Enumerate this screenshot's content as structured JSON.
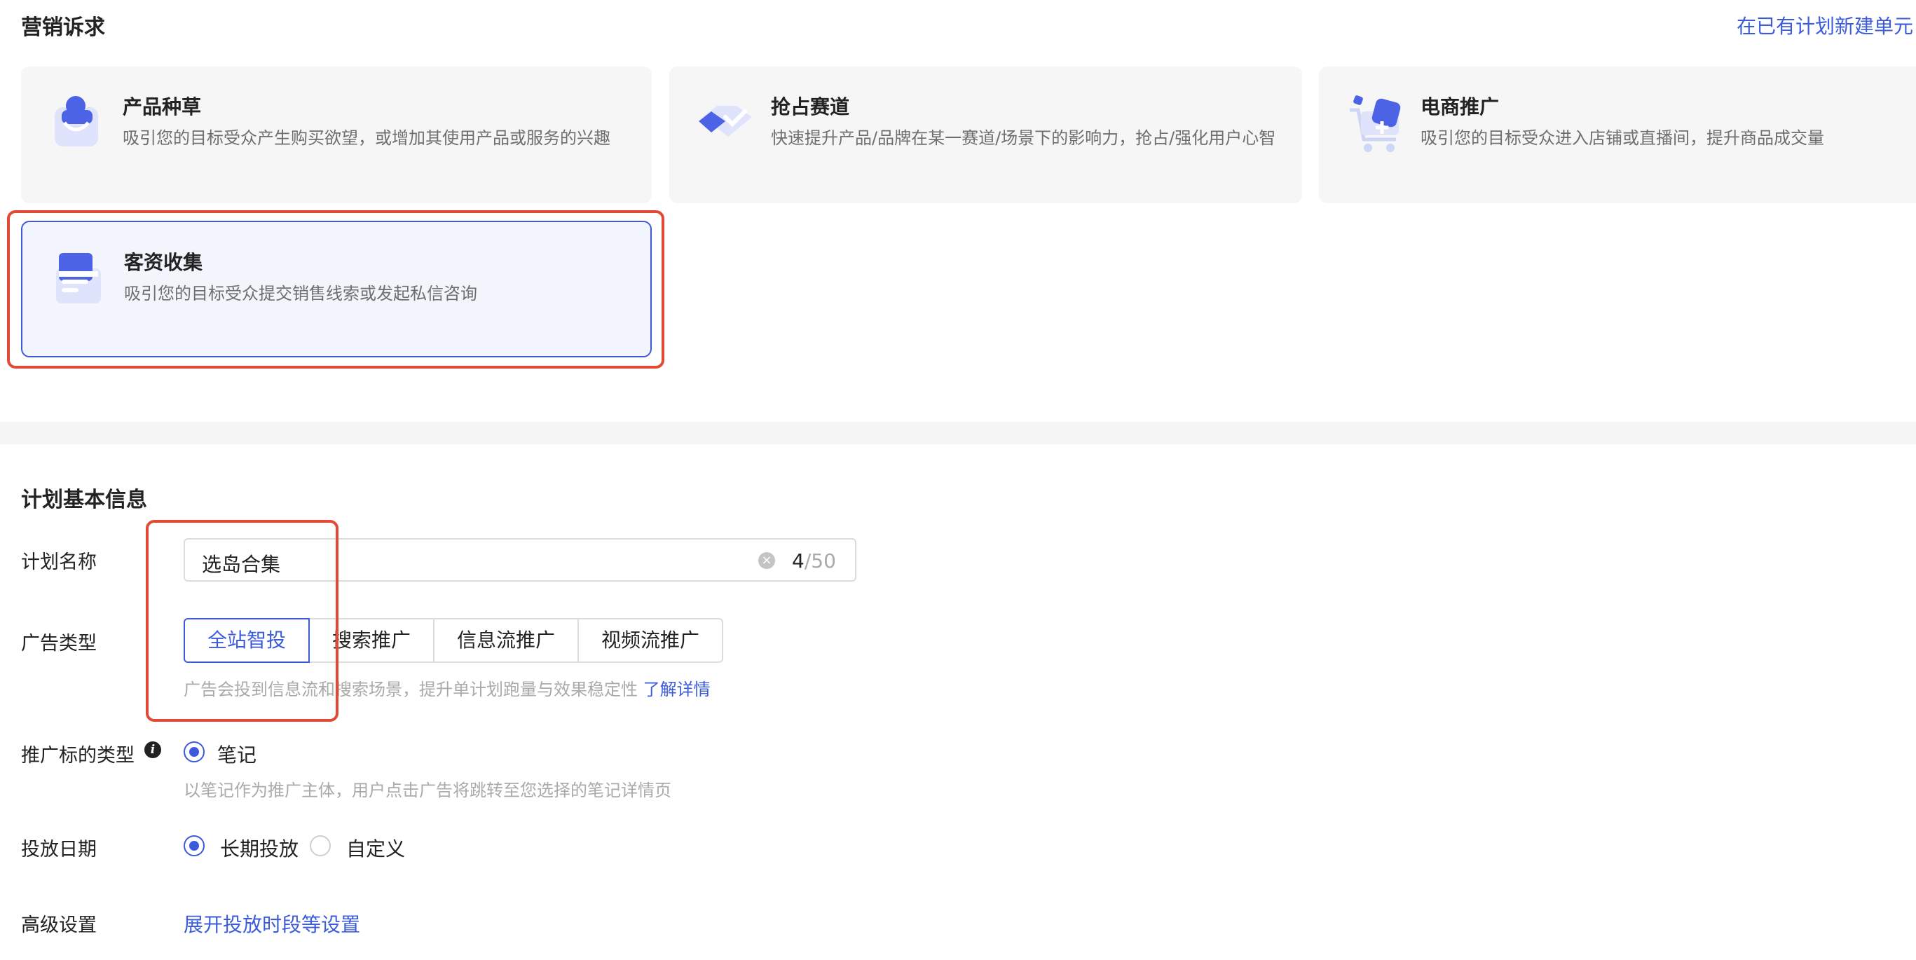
{
  "marketing": {
    "title": "营销诉求",
    "new_unit_link": "在已有计划新建单元",
    "cards": [
      {
        "title": "产品种草",
        "desc": "吸引您的目标受众产生购买欲望，或增加其使用产品或服务的兴趣",
        "icon": "shopping-bag-icon"
      },
      {
        "title": "抢占赛道",
        "desc": "快速提升产品/品牌在某一赛道/场景下的影响力，抢占/强化用户心智",
        "icon": "diamond-icon"
      },
      {
        "title": "电商推广",
        "desc": "吸引您的目标受众进入店铺或直播间，提升商品成交量",
        "icon": "shopping-cart-icon"
      },
      {
        "title": "客资收集",
        "desc": "吸引您的目标受众提交销售线索或发起私信咨询",
        "icon": "folder-card-icon",
        "selected": true
      }
    ]
  },
  "plan": {
    "title": "计划基本信息",
    "name_label": "计划名称",
    "name_value": "选岛合集",
    "name_count": "4",
    "name_max": "/50",
    "ad_type_label": "广告类型",
    "ad_types": [
      "全站智投",
      "搜索推广",
      "信息流推广",
      "视频流推广"
    ],
    "ad_type_selected": "全站智投",
    "ad_type_hint": "广告会投到信息流和搜索场景，提升单计划跑量与效果稳定性",
    "ad_type_hint_link": "了解详情",
    "target_type_label": "推广标的类型",
    "target_type_option": "笔记",
    "target_type_hint": "以笔记作为推广主体，用户点击广告将跳转至您选择的笔记详情页",
    "date_label": "投放日期",
    "date_options": [
      "长期投放",
      "自定义"
    ],
    "date_selected": "长期投放",
    "advanced_label": "高级设置",
    "advanced_link": "展开投放时段等设置"
  },
  "colors": {
    "accent": "#3b5bdb",
    "highlight_box": "#e24a35"
  }
}
